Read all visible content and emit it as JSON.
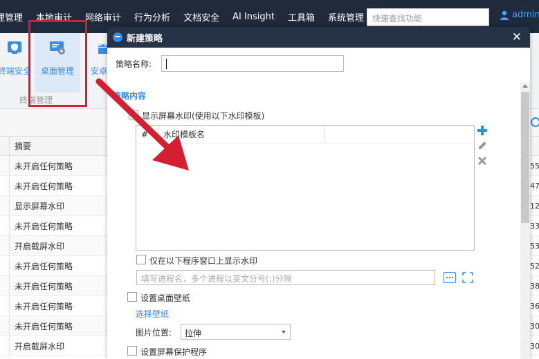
{
  "topbar": {
    "menu": [
      "理管理",
      "本地审计",
      "网络审计",
      "行为分析",
      "文档安全",
      "AI Insight",
      "工具箱",
      "系统管理"
    ],
    "search_placeholder": "快速查找功能",
    "user": "admin"
  },
  "ribbon": {
    "items": [
      {
        "label": "终端安全"
      },
      {
        "label": "桌面管理"
      },
      {
        "label": "安卓管"
      }
    ],
    "group_label": "终端管理"
  },
  "table": {
    "header": "摘要",
    "rows": [
      "未开启任何策略",
      "未开启任何策略",
      "显示屏幕水印",
      "未开启任何策略",
      "开启截屏水印",
      "未开启任何策略",
      "未开启任何策略",
      "未开启任何策略",
      "未开启任何策略",
      "开启截屏水印"
    ],
    "right_nums": [
      "55",
      "47",
      "12",
      "33",
      "53",
      "52",
      "38",
      "36",
      "30",
      "30"
    ]
  },
  "modal": {
    "title": "新建策略",
    "name_label": "策略名称:",
    "name_value": "",
    "section_title": "策略内容",
    "watermark_check": "显示屏幕水印(使用以下水印模板)",
    "tpl_col_num": "#",
    "tpl_col_name": "水印模板名",
    "only_program_check": "仅在以下程序窗口上显示水印",
    "process_placeholder": "填写进程名，多个进程以英文分号(;)分隔",
    "wallpaper_check": "设置桌面壁纸",
    "choose_wallpaper": "选择壁纸",
    "position_label": "图片位置:",
    "position_value": "拉伸",
    "screensaver_check": "设置屏幕保护程序"
  },
  "colors": {
    "accent": "#2d8cf0",
    "annotation": "#d31f30",
    "titlebar": "#263346"
  }
}
